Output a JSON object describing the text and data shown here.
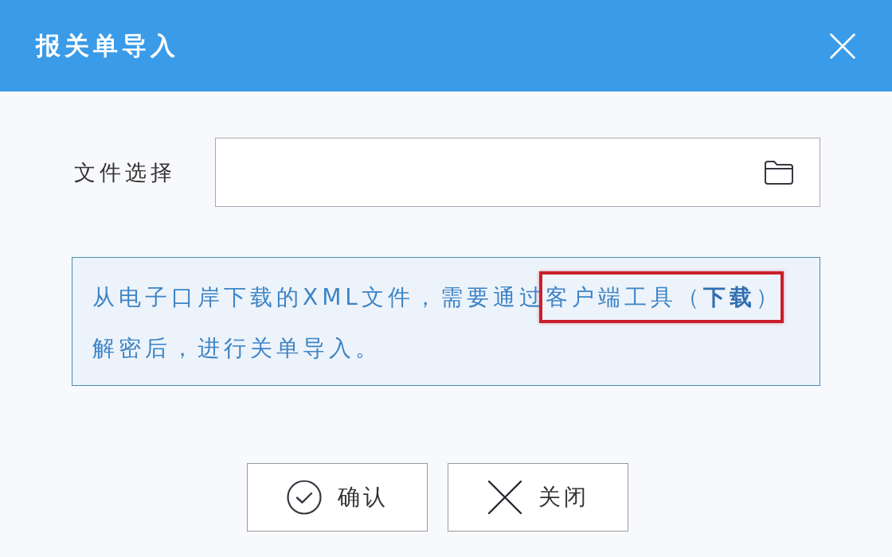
{
  "dialog": {
    "title": "报关单导入"
  },
  "file_field": {
    "label": "文件选择"
  },
  "notice": {
    "text": "从电子口岸下载的XML文件，需要通过",
    "highlight_text": "客户端工具（",
    "link": "下载",
    "highlight_end": "）",
    "text_end": "解密后，进行关单导入。",
    "highlighted": true
  },
  "buttons": [
    {
      "label": "确认",
      "kind": "confirm"
    },
    {
      "label": "关闭",
      "kind": "close"
    }
  ]
}
